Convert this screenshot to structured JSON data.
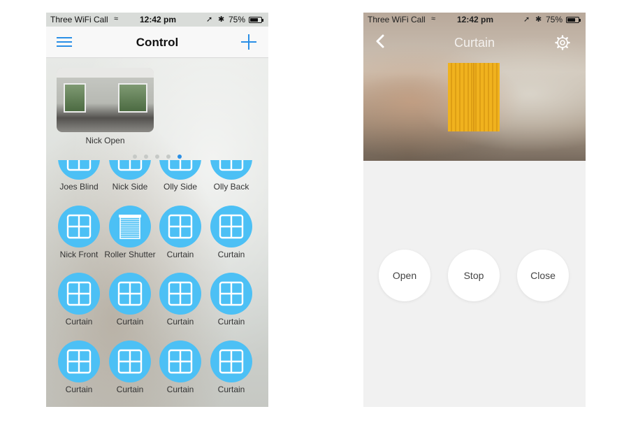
{
  "status_bar": {
    "carrier": "Three WiFi Call",
    "wifi_icon": "wifi-icon",
    "time": "12:42 pm",
    "battery": "75%",
    "battery_level": 0.75
  },
  "control_screen": {
    "title": "Control",
    "camera": {
      "label": "Nick Open"
    },
    "page_indicator": {
      "count": 5,
      "active_index": 4
    },
    "devices": [
      {
        "label": "Joes Blind",
        "icon": "window-icon"
      },
      {
        "label": "Nick Side",
        "icon": "window-icon"
      },
      {
        "label": "Olly Side",
        "icon": "window-icon"
      },
      {
        "label": "Olly Back",
        "icon": "window-icon"
      },
      {
        "label": "Nick Front",
        "icon": "window-icon"
      },
      {
        "label": "Roller Shutter",
        "icon": "roller-shutter-icon"
      },
      {
        "label": "Curtain",
        "icon": "window-icon"
      },
      {
        "label": "Curtain",
        "icon": "window-icon"
      },
      {
        "label": "Curtain",
        "icon": "window-icon"
      },
      {
        "label": "Curtain",
        "icon": "window-icon"
      },
      {
        "label": "Curtain",
        "icon": "window-icon"
      },
      {
        "label": "Curtain",
        "icon": "window-icon"
      },
      {
        "label": "Curtain",
        "icon": "window-icon"
      },
      {
        "label": "Curtain",
        "icon": "window-icon"
      },
      {
        "label": "Curtain",
        "icon": "window-icon"
      },
      {
        "label": "Curtain",
        "icon": "window-icon"
      }
    ]
  },
  "curtain_screen": {
    "title": "Curtain",
    "buttons": {
      "open": "Open",
      "stop": "Stop",
      "close": "Close"
    }
  },
  "colors": {
    "accent": "#2a8fe6",
    "device_circle": "#4cc0f5",
    "curtain": "#f0b21e"
  }
}
